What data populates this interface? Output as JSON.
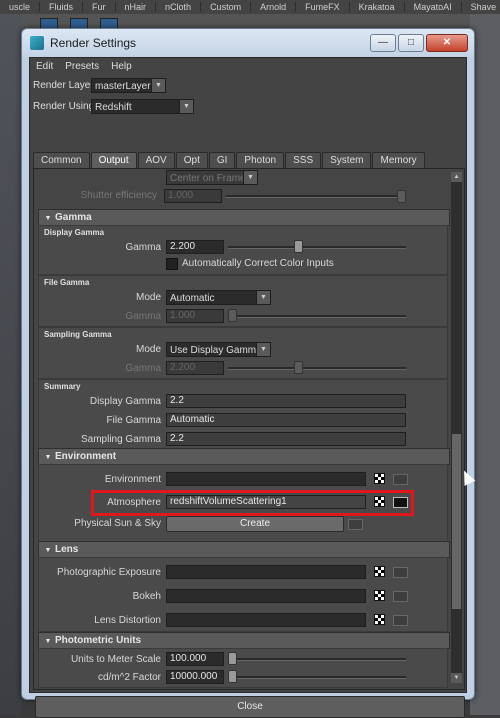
{
  "shelf": {
    "tabs": [
      "uscle",
      "Fluids",
      "Fur",
      "nHair",
      "nCloth",
      "Custom",
      "Arnold",
      "FumeFX",
      "Krakatoa",
      "MayatoAI",
      "Shave"
    ]
  },
  "window": {
    "title": "Render Settings",
    "buttons": {
      "minimize": "—",
      "maximize": "□",
      "close": "✕"
    }
  },
  "menu": [
    "Edit",
    "Presets",
    "Help"
  ],
  "render_layer": {
    "label": "Render Layer",
    "value": "masterLayer"
  },
  "render_using": {
    "label": "Render Using",
    "value": "Redshift"
  },
  "tabs": [
    {
      "label": "Common",
      "active": false
    },
    {
      "label": "Output",
      "active": true
    },
    {
      "label": "AOV",
      "active": false
    },
    {
      "label": "Opt",
      "active": false
    },
    {
      "label": "GI",
      "active": false
    },
    {
      "label": "Photon",
      "active": false
    },
    {
      "label": "SSS",
      "active": false
    },
    {
      "label": "System",
      "active": false
    },
    {
      "label": "Memory",
      "active": false
    }
  ],
  "top_partial": {
    "combo_value": "Center on Frame",
    "shutter_label": "Shutter efficiency",
    "shutter_value": "1.000"
  },
  "gamma": {
    "section": "Gamma",
    "display_group": "Display Gamma",
    "gamma_label": "Gamma",
    "gamma_value": "2.200",
    "auto_correct_label": "Automatically Correct Color Inputs",
    "file_group": "File Gamma",
    "mode_label": "Mode",
    "file_mode_value": "Automatic",
    "file_gamma_value": "1.000",
    "sampling_group": "Sampling Gamma",
    "sampling_mode_value": "Use Display Gamma",
    "sampling_gamma_value": "2.200",
    "summary_group": "Summary",
    "summary_display_label": "Display Gamma",
    "summary_display_value": "2.2",
    "summary_file_label": "File Gamma",
    "summary_file_value": "Automatic",
    "summary_sampling_label": "Sampling Gamma",
    "summary_sampling_value": "2.2"
  },
  "environment": {
    "section": "Environment",
    "environment_label": "Environment",
    "environment_value": "",
    "atmosphere_label": "Atmosphere",
    "atmosphere_value": "redshiftVolumeScattering1",
    "sun_label": "Physical Sun & Sky",
    "create_label": "Create"
  },
  "lens": {
    "section": "Lens",
    "exposure_label": "Photographic Exposure",
    "bokeh_label": "Bokeh",
    "distortion_label": "Lens Distortion"
  },
  "photometric": {
    "section": "Photometric Units",
    "units_label": "Units to Meter Scale",
    "units_value": "100.000",
    "cdm_label": "cd/m^2 Factor",
    "cdm_value": "10000.000"
  },
  "footer": {
    "close_label": "Close"
  },
  "colors": {
    "highlight": "#e0181e",
    "panel_bg": "#454545"
  }
}
